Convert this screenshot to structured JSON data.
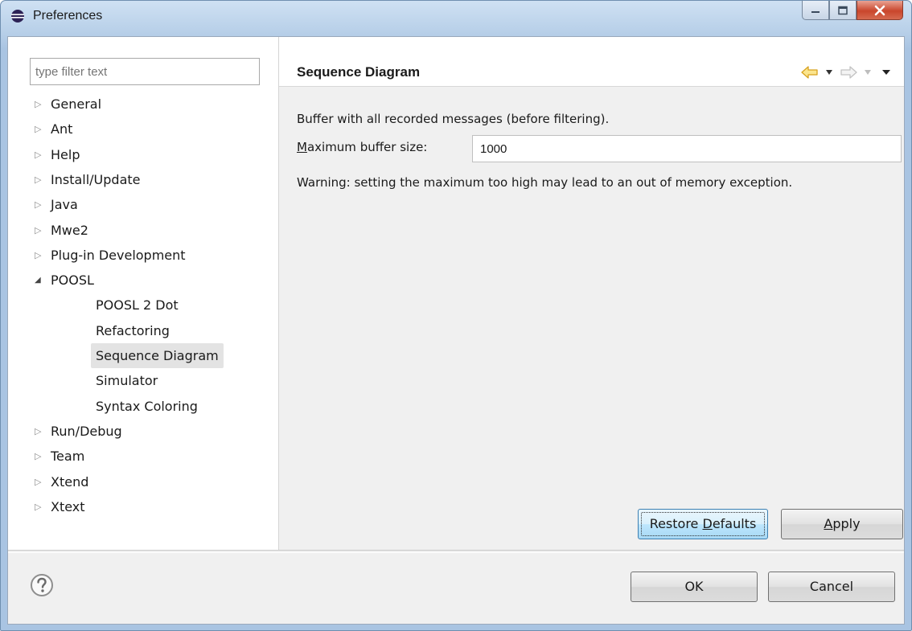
{
  "window": {
    "title": "Preferences",
    "icon": "eclipse-icon",
    "controls": [
      "minimize-icon",
      "maximize-icon",
      "close-icon"
    ]
  },
  "filter": {
    "placeholder": "type filter text",
    "value": ""
  },
  "tree": [
    {
      "label": "General",
      "expanded": false
    },
    {
      "label": "Ant",
      "expanded": false
    },
    {
      "label": "Help",
      "expanded": false
    },
    {
      "label": "Install/Update",
      "expanded": false
    },
    {
      "label": "Java",
      "expanded": false
    },
    {
      "label": "Mwe2",
      "expanded": false
    },
    {
      "label": "Plug-in Development",
      "expanded": false
    },
    {
      "label": "POOSL",
      "expanded": true,
      "children": [
        {
          "label": "POOSL 2 Dot"
        },
        {
          "label": "Refactoring"
        },
        {
          "label": "Sequence Diagram",
          "selected": true
        },
        {
          "label": "Simulator"
        },
        {
          "label": "Syntax Coloring"
        }
      ]
    },
    {
      "label": "Run/Debug",
      "expanded": false
    },
    {
      "label": "Team",
      "expanded": false
    },
    {
      "label": "Xtend",
      "expanded": false
    },
    {
      "label": "Xtext",
      "expanded": false
    }
  ],
  "page": {
    "title": "Sequence Diagram",
    "description": "Buffer with all recorded messages (before filtering).",
    "field_label_first": "M",
    "field_label_rest": "aximum buffer size:",
    "buffer_value": "1000",
    "warning": "Warning: setting the maximum too high may lead to an out of memory exception.",
    "nav_icons": [
      "back-arrow-icon",
      "back-dropdown-icon",
      "forward-arrow-icon",
      "forward-dropdown-icon",
      "view-menu-icon"
    ]
  },
  "buttons": {
    "restore_pre": "Restore ",
    "restore_mn": "D",
    "restore_post": "efaults",
    "apply_mn": "A",
    "apply_post": "pply",
    "ok": "OK",
    "cancel": "Cancel"
  },
  "colors": {
    "selection": "#e3e3e3",
    "back_arrow": "#f2c94c",
    "default_button": "#bee6fd",
    "close_button": "#c9462c"
  }
}
